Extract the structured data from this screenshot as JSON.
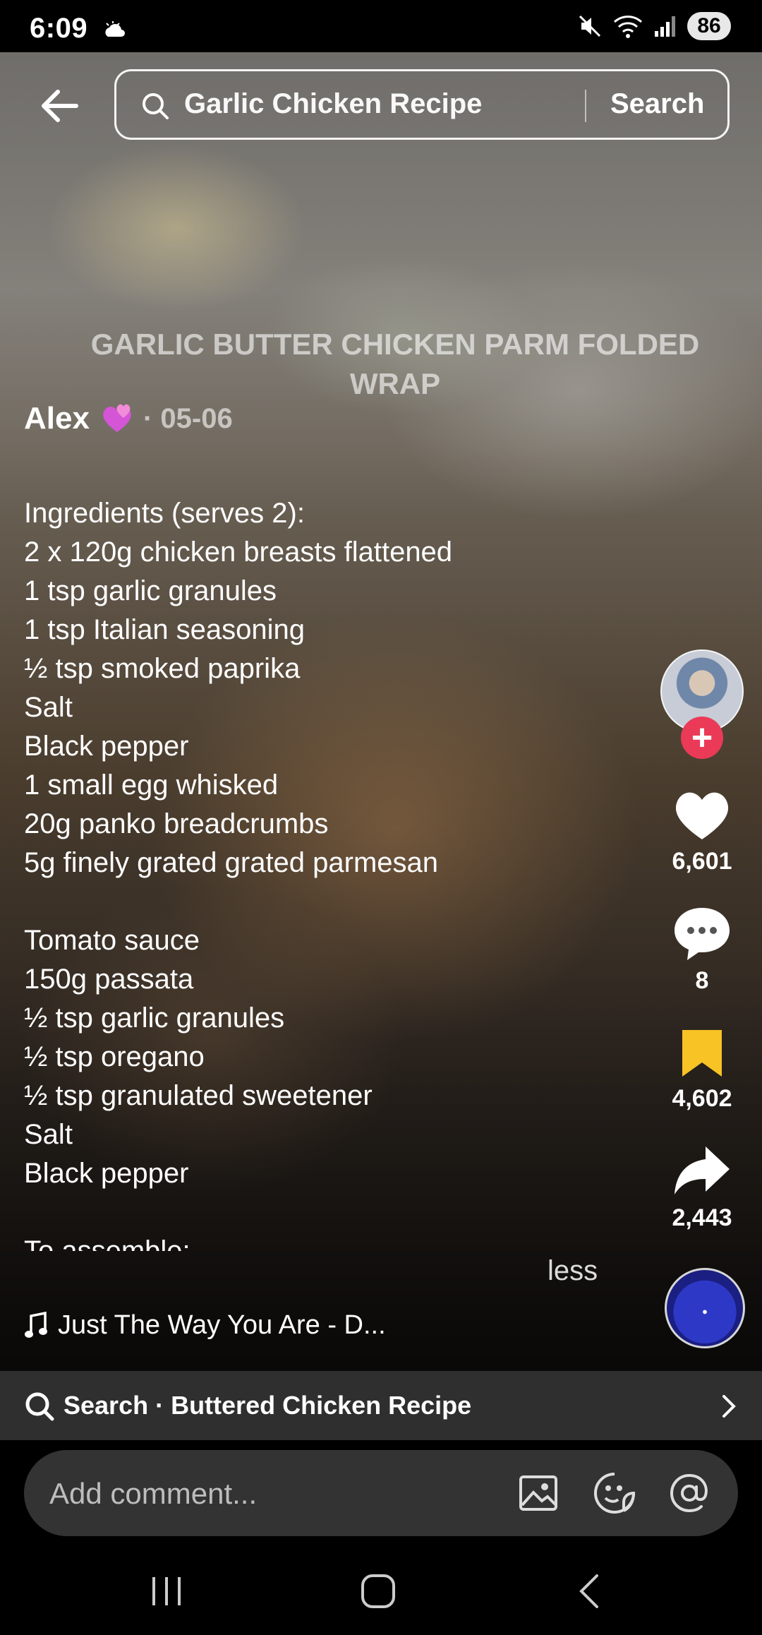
{
  "status_bar": {
    "time": "6:09",
    "battery": "86",
    "icons": [
      "weather-icon",
      "mute-icon",
      "wifi-icon",
      "signal-icon"
    ]
  },
  "search": {
    "query": "Garlic Chicken Recipe",
    "button_label": "Search"
  },
  "video": {
    "overlay_title": "GARLIC BUTTER CHICKEN PARM FOLDED WRAP"
  },
  "post": {
    "author": "Alex",
    "date": "· 05-06",
    "description_lines": [
      "Ingredients (serves 2):",
      "2 x 120g chicken breasts flattened",
      "1 tsp garlic granules",
      "1 tsp Italian seasoning",
      "½ tsp smoked paprika",
      "Salt",
      "Black pepper",
      "1 small egg whisked",
      "20g panko breadcrumbs",
      "5g finely grated grated parmesan",
      "",
      "Tomato sauce",
      "150g passata",
      "½ tsp garlic granules",
      "½ tsp oregano",
      "½ tsp granulated sweetener",
      "Salt",
      "Black pepper",
      "",
      "To assemble:"
    ],
    "less_label": "less",
    "music": "Just The Way You Are - D..."
  },
  "actions": {
    "likes": "6,601",
    "comments": "8",
    "saves": "4,602",
    "shares": "2,443",
    "follow_symbol": "+"
  },
  "related_search": {
    "label": "Search · Buttered Chicken Recipe"
  },
  "comment": {
    "placeholder": "Add comment..."
  },
  "colors": {
    "like": "#ffffff",
    "save": "#f7c325",
    "follow": "#ea3a57",
    "bar": "#2f2f2f"
  }
}
